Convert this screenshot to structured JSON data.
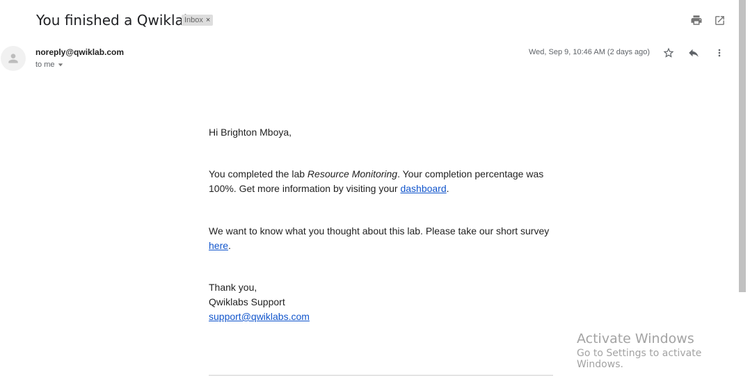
{
  "email": {
    "subject": "You finished a Qwiklab",
    "label": "Inbox",
    "label_remove": "×",
    "sender": "noreply@qwiklab.com",
    "recipient": "to me",
    "date": "Wed, Sep 9, 10:46 AM (2 days ago)",
    "body": {
      "greeting": "Hi Brighton Mboya,",
      "p1_before": "You completed the lab ",
      "p1_lab": "Resource Monitoring",
      "p1_after": ". Your completion percentage was 100%. Get more information by visiting your ",
      "p1_link": "dashboard",
      "p1_end": ".",
      "p2_before": "We want to know what you thought about this lab. Please take our short survey ",
      "p2_link": "here",
      "p2_end": ".",
      "closing": "Thank you,",
      "signature": "Qwiklabs Support",
      "support_email": "support@qwiklabs.com"
    }
  },
  "icons": {
    "print": "print-icon",
    "open_new_window": "open-in-new-window-icon",
    "avatar": "person-avatar-icon",
    "star": "star-icon",
    "reply": "reply-icon",
    "more": "more-vertical-icon",
    "dropdown": "caret-down-icon"
  },
  "watermark": {
    "title": "Activate Windows",
    "subtitle": "Go to Settings to activate Windows."
  },
  "colors": {
    "link": "#1155cc",
    "chip_bg": "#dddddd",
    "muted_text": "#5f6368"
  }
}
